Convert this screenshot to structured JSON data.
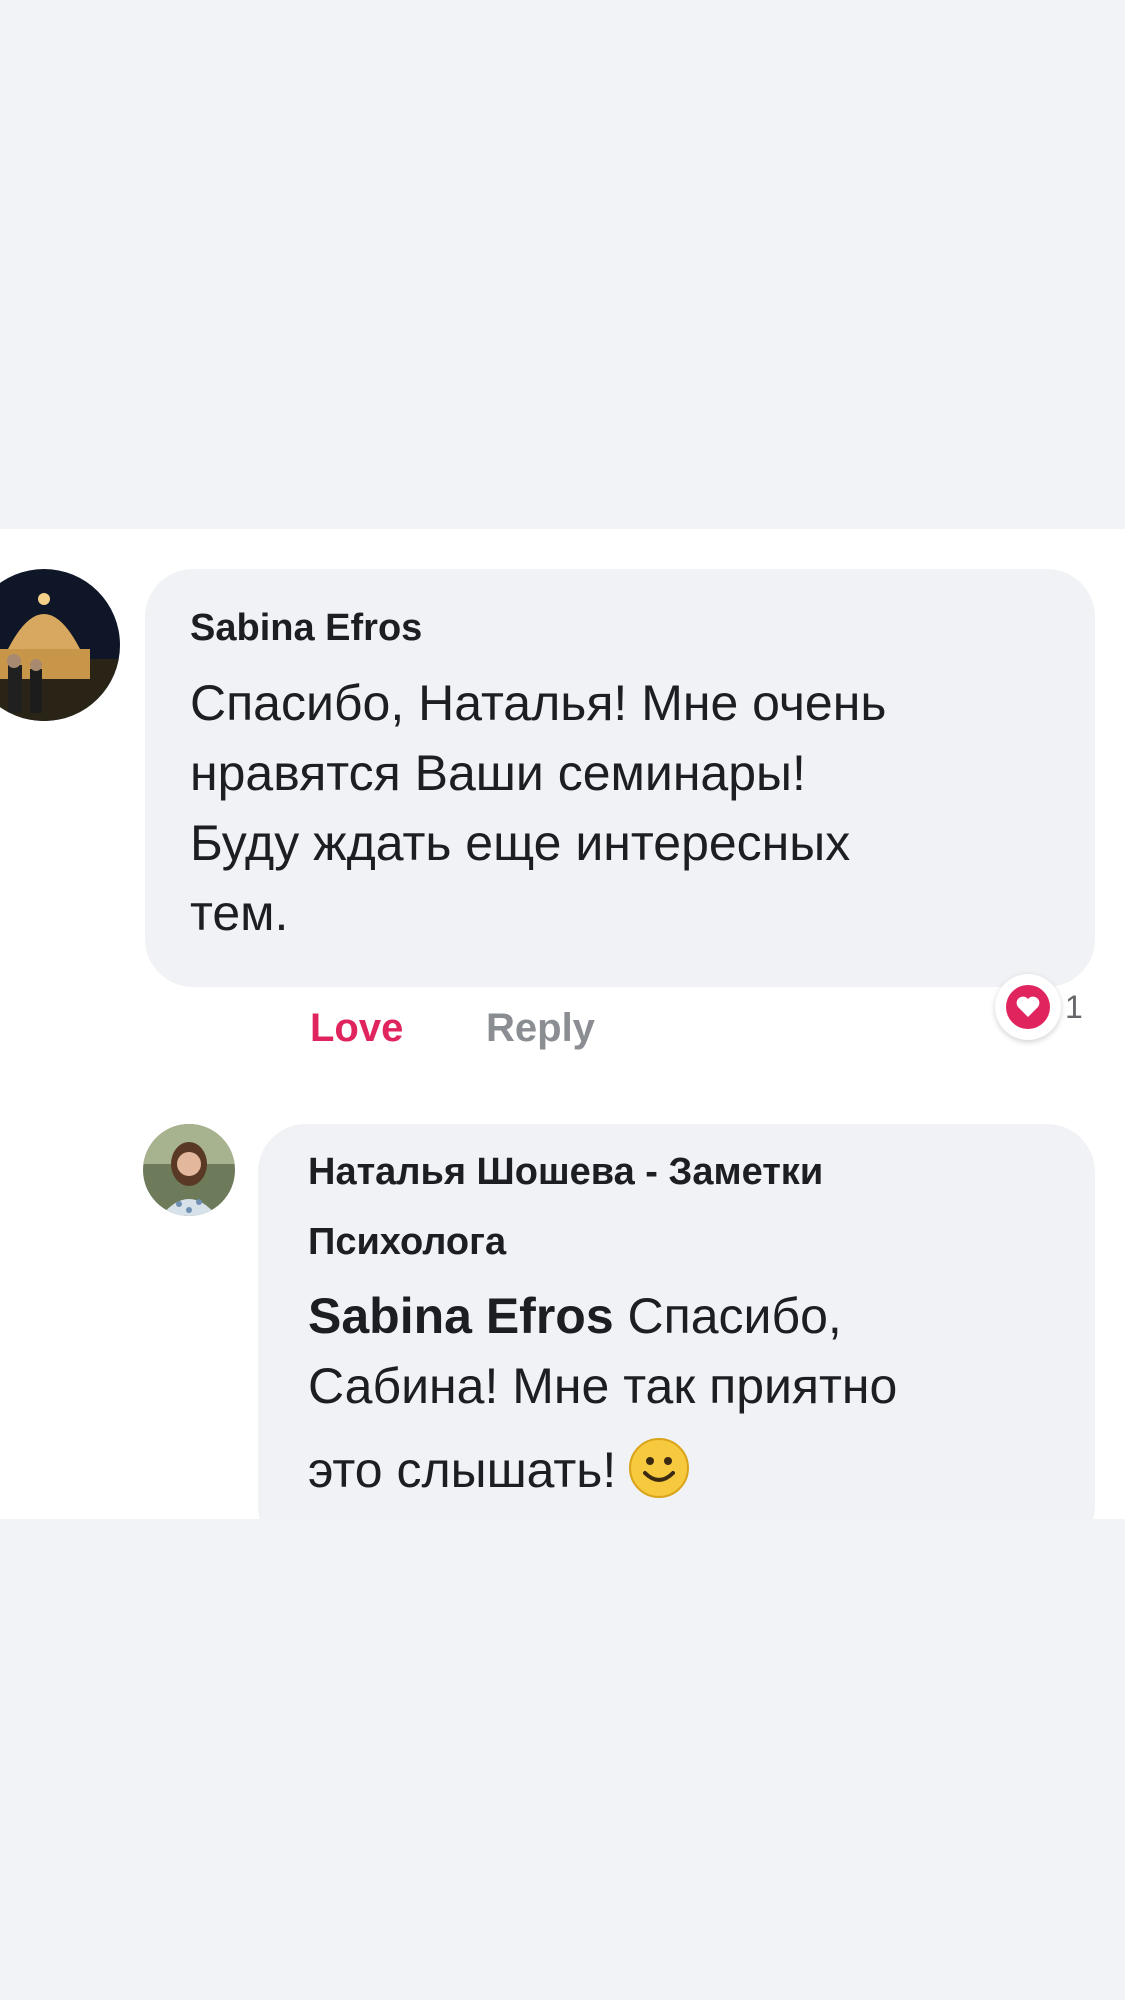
{
  "comment": {
    "author": "Sabina Efros",
    "lines": [
      "Спасибо, Наталья! Мне очень",
      "нравятся Ваши семинары!",
      "Буду ждать еще интересных",
      "тем."
    ],
    "actions": {
      "love": "Love",
      "reply": "Reply"
    },
    "reaction": {
      "icon": "heart-icon",
      "count": "1",
      "color": "#e0245e"
    }
  },
  "reply": {
    "author_lines": [
      "Наталья Шошева - Заметки",
      "Психолога"
    ],
    "mention": "Sabina Efros",
    "lines": [
      " Спасибо,",
      "Сабина! Мне так приятно",
      "это слышать!"
    ],
    "emoji": "smiley-emoji"
  }
}
